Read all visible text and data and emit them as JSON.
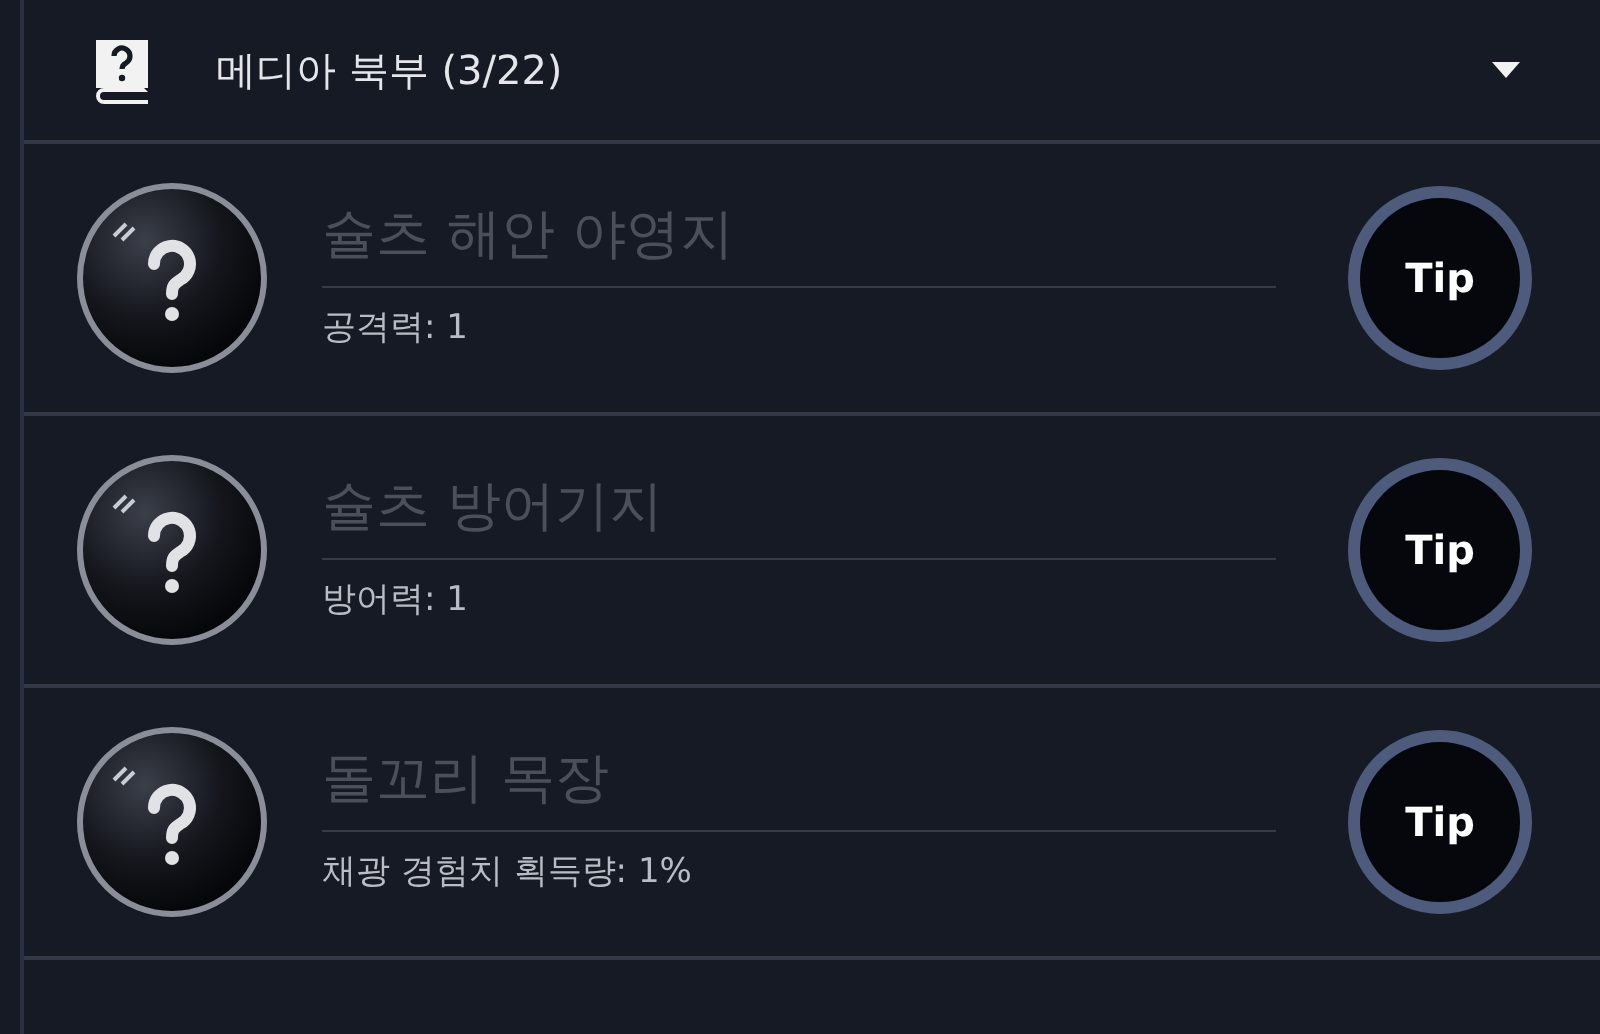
{
  "section": {
    "title": "메디아 북부 (3/22)",
    "expanded": true
  },
  "entries": [
    {
      "title": "슐츠 해안 야영지",
      "stat": "공격력: 1",
      "discovered": false,
      "tip_label": "Tip"
    },
    {
      "title": "슐츠 방어기지",
      "stat": "방어력: 1",
      "discovered": false,
      "tip_label": "Tip"
    },
    {
      "title": "돌꼬리 목장",
      "stat": "채광 경험치 획득량: 1%",
      "discovered": false,
      "tip_label": "Tip"
    }
  ]
}
